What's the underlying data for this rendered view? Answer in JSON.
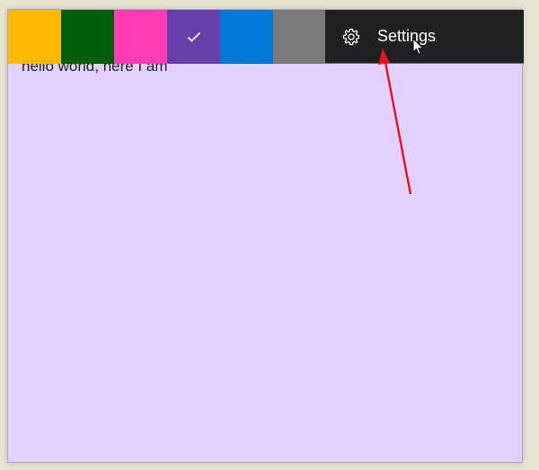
{
  "note": {
    "text": "hello world, here I am"
  },
  "color_bar": {
    "swatches": [
      {
        "name": "yellow",
        "color": "#ffb900",
        "selected": false
      },
      {
        "name": "green",
        "color": "#005e0b",
        "selected": false
      },
      {
        "name": "pink",
        "color": "#ff3cb4",
        "selected": false
      },
      {
        "name": "purple",
        "color": "#6741a9",
        "selected": true
      },
      {
        "name": "blue",
        "color": "#0078d7",
        "selected": false
      },
      {
        "name": "gray",
        "color": "#7a7a7a",
        "selected": false
      }
    ]
  },
  "settings_menu": {
    "icon": "gear-icon",
    "label": "Settings"
  },
  "colors": {
    "note_background": "#e2d0fd",
    "menu_background": "#202020",
    "annotation": "#e8141b"
  }
}
